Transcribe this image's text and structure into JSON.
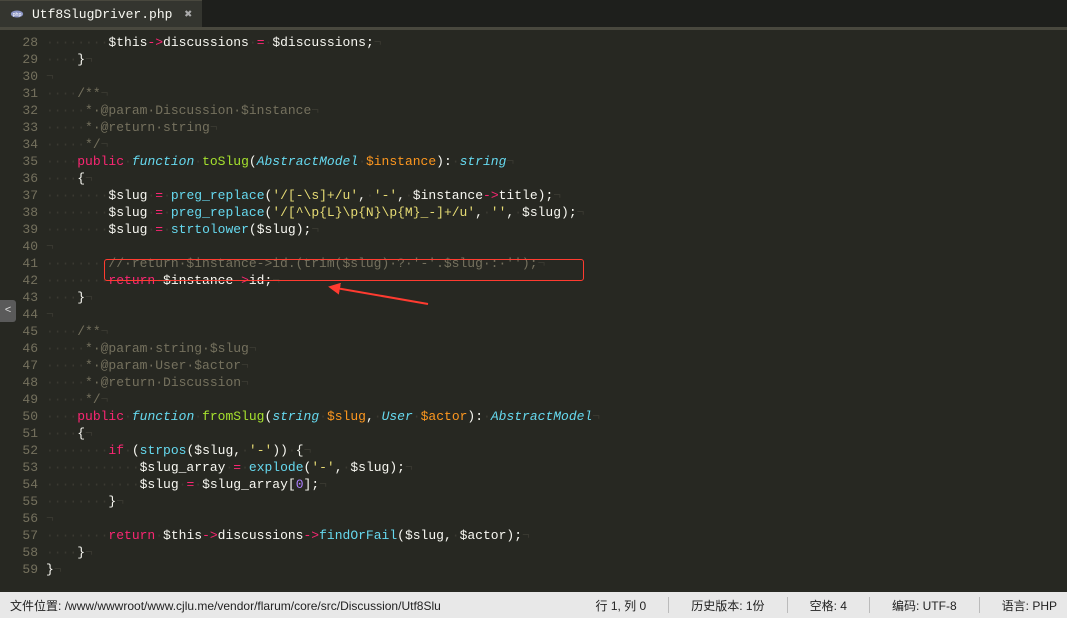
{
  "tab": {
    "filename": "Utf8SlugDriver.php",
    "dirty": "✖"
  },
  "gutter": [
    "28",
    "29",
    "30",
    "31",
    "32",
    "33",
    "34",
    "35",
    "36",
    "37",
    "38",
    "39",
    "40",
    "41",
    "42",
    "43",
    "44",
    "45",
    "46",
    "47",
    "48",
    "49",
    "50",
    "51",
    "52",
    "53",
    "54",
    "55",
    "56",
    "57",
    "58",
    "59"
  ],
  "lines": [
    [
      {
        "c": "c-ws",
        "t": "········"
      },
      {
        "c": "c-var",
        "t": "$this"
      },
      {
        "c": "c-op",
        "t": "->"
      },
      {
        "c": "c-prop",
        "t": "discussions"
      },
      {
        "c": "c-ws",
        "t": "·"
      },
      {
        "c": "c-op",
        "t": "="
      },
      {
        "c": "c-ws",
        "t": "·"
      },
      {
        "c": "c-var",
        "t": "$discussions"
      },
      {
        "c": "c-punct",
        "t": ";"
      },
      {
        "c": "c-ws",
        "t": "¬"
      }
    ],
    [
      {
        "c": "c-ws",
        "t": "····"
      },
      {
        "c": "c-punct",
        "t": "}"
      },
      {
        "c": "c-ws",
        "t": "¬"
      }
    ],
    [
      {
        "c": "c-ws",
        "t": "¬"
      }
    ],
    [
      {
        "c": "c-ws",
        "t": "····"
      },
      {
        "c": "c-comment",
        "t": "/**"
      },
      {
        "c": "c-ws",
        "t": "¬"
      }
    ],
    [
      {
        "c": "c-ws",
        "t": "·····"
      },
      {
        "c": "c-comment",
        "t": "*·@param·Discussion·$instance"
      },
      {
        "c": "c-ws",
        "t": "¬"
      }
    ],
    [
      {
        "c": "c-ws",
        "t": "·····"
      },
      {
        "c": "c-comment",
        "t": "*·@return·string"
      },
      {
        "c": "c-ws",
        "t": "¬"
      }
    ],
    [
      {
        "c": "c-ws",
        "t": "·····"
      },
      {
        "c": "c-comment",
        "t": "*/"
      },
      {
        "c": "c-ws",
        "t": "¬"
      }
    ],
    [
      {
        "c": "c-ws",
        "t": "····"
      },
      {
        "c": "c-kw2",
        "t": "public"
      },
      {
        "c": "c-ws",
        "t": "·"
      },
      {
        "c": "c-kw",
        "t": "function"
      },
      {
        "c": "c-ws",
        "t": "·"
      },
      {
        "c": "c-fn",
        "t": "toSlug"
      },
      {
        "c": "c-punct",
        "t": "("
      },
      {
        "c": "c-type",
        "t": "AbstractModel"
      },
      {
        "c": "c-ws",
        "t": "·"
      },
      {
        "c": "c-param",
        "t": "$instance"
      },
      {
        "c": "c-punct",
        "t": "):"
      },
      {
        "c": "c-ws",
        "t": "·"
      },
      {
        "c": "c-type",
        "t": "string"
      },
      {
        "c": "c-ws",
        "t": "¬"
      }
    ],
    [
      {
        "c": "c-ws",
        "t": "····"
      },
      {
        "c": "c-punct",
        "t": "{"
      },
      {
        "c": "c-ws",
        "t": "¬"
      }
    ],
    [
      {
        "c": "c-ws",
        "t": "········"
      },
      {
        "c": "c-var",
        "t": "$slug"
      },
      {
        "c": "c-ws",
        "t": "·"
      },
      {
        "c": "c-op",
        "t": "="
      },
      {
        "c": "c-ws",
        "t": "·"
      },
      {
        "c": "c-call",
        "t": "preg_replace"
      },
      {
        "c": "c-punct",
        "t": "("
      },
      {
        "c": "c-str",
        "t": "'/[-\\s]+/u'"
      },
      {
        "c": "c-punct",
        "t": ","
      },
      {
        "c": "c-ws",
        "t": "·"
      },
      {
        "c": "c-str",
        "t": "'-'"
      },
      {
        "c": "c-punct",
        "t": ","
      },
      {
        "c": "c-ws",
        "t": "·"
      },
      {
        "c": "c-var",
        "t": "$instance"
      },
      {
        "c": "c-op",
        "t": "->"
      },
      {
        "c": "c-prop",
        "t": "title"
      },
      {
        "c": "c-punct",
        "t": ");"
      },
      {
        "c": "c-ws",
        "t": "¬"
      }
    ],
    [
      {
        "c": "c-ws",
        "t": "········"
      },
      {
        "c": "c-var",
        "t": "$slug"
      },
      {
        "c": "c-ws",
        "t": "·"
      },
      {
        "c": "c-op",
        "t": "="
      },
      {
        "c": "c-ws",
        "t": "·"
      },
      {
        "c": "c-call",
        "t": "preg_replace"
      },
      {
        "c": "c-punct",
        "t": "("
      },
      {
        "c": "c-str",
        "t": "'/[^\\p{L}\\p{N}\\p{M}_-]+/u'"
      },
      {
        "c": "c-punct",
        "t": ","
      },
      {
        "c": "c-ws",
        "t": "·"
      },
      {
        "c": "c-str",
        "t": "''"
      },
      {
        "c": "c-punct",
        "t": ","
      },
      {
        "c": "c-ws",
        "t": "·"
      },
      {
        "c": "c-var",
        "t": "$slug"
      },
      {
        "c": "c-punct",
        "t": ");"
      },
      {
        "c": "c-ws",
        "t": "¬"
      }
    ],
    [
      {
        "c": "c-ws",
        "t": "········"
      },
      {
        "c": "c-var",
        "t": "$slug"
      },
      {
        "c": "c-ws",
        "t": "·"
      },
      {
        "c": "c-op",
        "t": "="
      },
      {
        "c": "c-ws",
        "t": "·"
      },
      {
        "c": "c-call",
        "t": "strtolower"
      },
      {
        "c": "c-punct",
        "t": "("
      },
      {
        "c": "c-var",
        "t": "$slug"
      },
      {
        "c": "c-punct",
        "t": ");"
      },
      {
        "c": "c-ws",
        "t": "¬"
      }
    ],
    [
      {
        "c": "c-ws",
        "t": "¬"
      }
    ],
    [
      {
        "c": "c-ws",
        "t": "·"
      },
      {
        "c": "c-ws",
        "t": "·······"
      },
      {
        "c": "c-comment",
        "t": "//·return·$instance->id.(trim($slug)·?·'-'.$slug·:·'');"
      },
      {
        "c": "c-ws",
        "t": "¬"
      }
    ],
    [
      {
        "c": "c-ws",
        "t": "········"
      },
      {
        "c": "c-kw2",
        "t": "return"
      },
      {
        "c": "c-ws",
        "t": "·"
      },
      {
        "c": "c-var",
        "t": "$instance"
      },
      {
        "c": "c-op",
        "t": "->"
      },
      {
        "c": "c-prop",
        "t": "id"
      },
      {
        "c": "c-punct",
        "t": ";"
      },
      {
        "c": "c-ws",
        "t": "¬"
      }
    ],
    [
      {
        "c": "c-ws",
        "t": "····"
      },
      {
        "c": "c-punct",
        "t": "}"
      },
      {
        "c": "c-ws",
        "t": "¬"
      }
    ],
    [
      {
        "c": "c-ws",
        "t": "¬"
      }
    ],
    [
      {
        "c": "c-ws",
        "t": "····"
      },
      {
        "c": "c-comment",
        "t": "/**"
      },
      {
        "c": "c-ws",
        "t": "¬"
      }
    ],
    [
      {
        "c": "c-ws",
        "t": "·····"
      },
      {
        "c": "c-comment",
        "t": "*·@param·string·$slug"
      },
      {
        "c": "c-ws",
        "t": "¬"
      }
    ],
    [
      {
        "c": "c-ws",
        "t": "·····"
      },
      {
        "c": "c-comment",
        "t": "*·@param·User·$actor"
      },
      {
        "c": "c-ws",
        "t": "¬"
      }
    ],
    [
      {
        "c": "c-ws",
        "t": "·····"
      },
      {
        "c": "c-comment",
        "t": "*·@return·Discussion"
      },
      {
        "c": "c-ws",
        "t": "¬"
      }
    ],
    [
      {
        "c": "c-ws",
        "t": "·····"
      },
      {
        "c": "c-comment",
        "t": "*/"
      },
      {
        "c": "c-ws",
        "t": "¬"
      }
    ],
    [
      {
        "c": "c-ws",
        "t": "····"
      },
      {
        "c": "c-kw2",
        "t": "public"
      },
      {
        "c": "c-ws",
        "t": "·"
      },
      {
        "c": "c-kw",
        "t": "function"
      },
      {
        "c": "c-ws",
        "t": "·"
      },
      {
        "c": "c-fn",
        "t": "fromSlug"
      },
      {
        "c": "c-punct",
        "t": "("
      },
      {
        "c": "c-type",
        "t": "string"
      },
      {
        "c": "c-ws",
        "t": "·"
      },
      {
        "c": "c-param",
        "t": "$slug"
      },
      {
        "c": "c-punct",
        "t": ","
      },
      {
        "c": "c-ws",
        "t": "·"
      },
      {
        "c": "c-type",
        "t": "User"
      },
      {
        "c": "c-ws",
        "t": "·"
      },
      {
        "c": "c-param",
        "t": "$actor"
      },
      {
        "c": "c-punct",
        "t": "):"
      },
      {
        "c": "c-ws",
        "t": "·"
      },
      {
        "c": "c-type",
        "t": "AbstractModel"
      },
      {
        "c": "c-ws",
        "t": "¬"
      }
    ],
    [
      {
        "c": "c-ws",
        "t": "····"
      },
      {
        "c": "c-punct",
        "t": "{"
      },
      {
        "c": "c-ws",
        "t": "¬"
      }
    ],
    [
      {
        "c": "c-ws",
        "t": "········"
      },
      {
        "c": "c-kw2",
        "t": "if"
      },
      {
        "c": "c-ws",
        "t": "·"
      },
      {
        "c": "c-punct",
        "t": "("
      },
      {
        "c": "c-call",
        "t": "strpos"
      },
      {
        "c": "c-punct",
        "t": "("
      },
      {
        "c": "c-var",
        "t": "$slug"
      },
      {
        "c": "c-punct",
        "t": ","
      },
      {
        "c": "c-ws",
        "t": "·"
      },
      {
        "c": "c-str",
        "t": "'-'"
      },
      {
        "c": "c-punct",
        "t": "))"
      },
      {
        "c": "c-ws",
        "t": "·"
      },
      {
        "c": "c-punct",
        "t": "{"
      },
      {
        "c": "c-ws",
        "t": "¬"
      }
    ],
    [
      {
        "c": "c-ws",
        "t": "············"
      },
      {
        "c": "c-var",
        "t": "$slug_array"
      },
      {
        "c": "c-ws",
        "t": "·"
      },
      {
        "c": "c-op",
        "t": "="
      },
      {
        "c": "c-ws",
        "t": "·"
      },
      {
        "c": "c-call",
        "t": "explode"
      },
      {
        "c": "c-punct",
        "t": "("
      },
      {
        "c": "c-str",
        "t": "'-'"
      },
      {
        "c": "c-punct",
        "t": ","
      },
      {
        "c": "c-ws",
        "t": "·"
      },
      {
        "c": "c-var",
        "t": "$slug"
      },
      {
        "c": "c-punct",
        "t": ");"
      },
      {
        "c": "c-ws",
        "t": "¬"
      }
    ],
    [
      {
        "c": "c-ws",
        "t": "············"
      },
      {
        "c": "c-var",
        "t": "$slug"
      },
      {
        "c": "c-ws",
        "t": "·"
      },
      {
        "c": "c-op",
        "t": "="
      },
      {
        "c": "c-ws",
        "t": "·"
      },
      {
        "c": "c-var",
        "t": "$slug_array"
      },
      {
        "c": "c-punct",
        "t": "["
      },
      {
        "c": "c-num",
        "t": "0"
      },
      {
        "c": "c-punct",
        "t": "];"
      },
      {
        "c": "c-ws",
        "t": "¬"
      }
    ],
    [
      {
        "c": "c-ws",
        "t": "········"
      },
      {
        "c": "c-punct",
        "t": "}"
      },
      {
        "c": "c-ws",
        "t": "¬"
      }
    ],
    [
      {
        "c": "c-ws",
        "t": "¬"
      }
    ],
    [
      {
        "c": "c-ws",
        "t": "········"
      },
      {
        "c": "c-kw2",
        "t": "return"
      },
      {
        "c": "c-ws",
        "t": "·"
      },
      {
        "c": "c-var",
        "t": "$this"
      },
      {
        "c": "c-op",
        "t": "->"
      },
      {
        "c": "c-prop",
        "t": "discussions"
      },
      {
        "c": "c-op",
        "t": "->"
      },
      {
        "c": "c-call",
        "t": "findOrFail"
      },
      {
        "c": "c-punct",
        "t": "("
      },
      {
        "c": "c-var",
        "t": "$slug"
      },
      {
        "c": "c-punct",
        "t": ","
      },
      {
        "c": "c-ws",
        "t": "·"
      },
      {
        "c": "c-var",
        "t": "$actor"
      },
      {
        "c": "c-punct",
        "t": ");"
      },
      {
        "c": "c-ws",
        "t": "¬"
      }
    ],
    [
      {
        "c": "c-ws",
        "t": "····"
      },
      {
        "c": "c-punct",
        "t": "}"
      },
      {
        "c": "c-ws",
        "t": "¬"
      }
    ],
    [
      {
        "c": "c-punct",
        "t": "}"
      },
      {
        "c": "c-ws",
        "t": "¬"
      }
    ]
  ],
  "status": {
    "path_label": "文件位置:",
    "path": "/www/wwwroot/www.cjlu.me/vendor/flarum/core/src/Discussion/Utf8Slu",
    "cursor_label": "行 1, 列 0",
    "history_label": "历史版本:",
    "history_value": "1份",
    "indent_label": "空格:",
    "indent_value": "4",
    "encoding_label": "编码:",
    "encoding_value": "UTF-8",
    "lang_label": "语言:",
    "lang_value": "PHP",
    "left_handle": "<"
  }
}
